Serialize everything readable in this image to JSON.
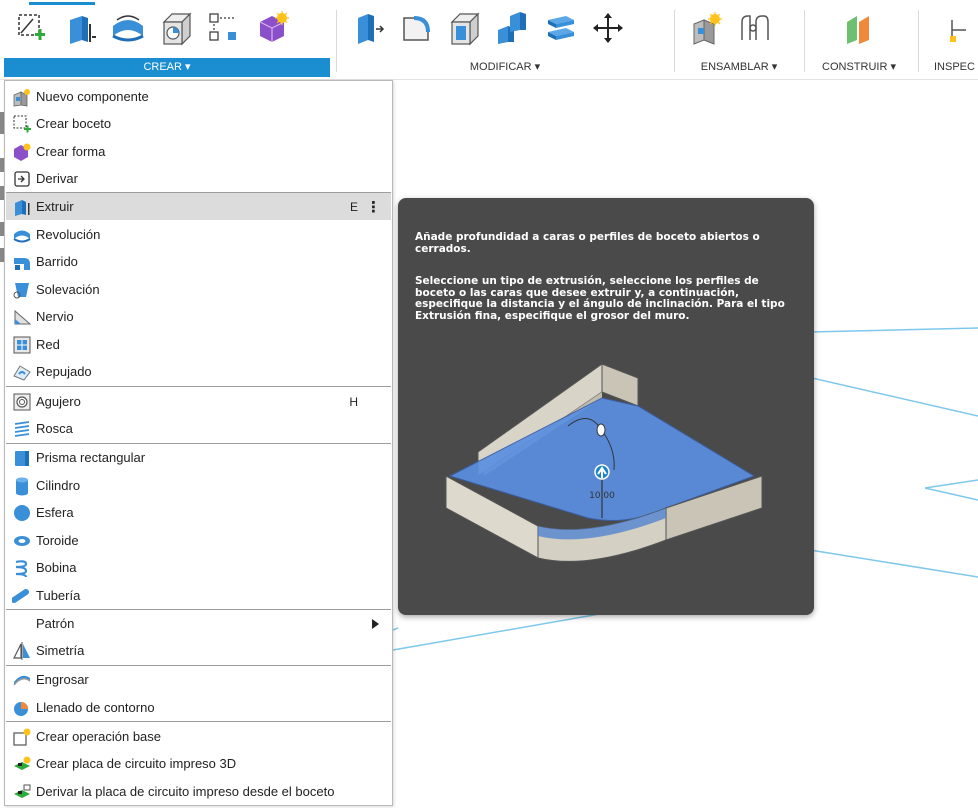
{
  "toolbar": {
    "groups": {
      "crear": "CREAR ▾",
      "modificar": "MODIFICAR ▾",
      "ensamblar": "ENSAMBLAR ▾",
      "construir": "CONSTRUIR ▾",
      "inspeccionar": "INSPEC"
    }
  },
  "menu": {
    "items": [
      {
        "label": "Nuevo componente",
        "shortcut": ""
      },
      {
        "label": "Crear boceto",
        "shortcut": ""
      },
      {
        "label": "Crear forma",
        "shortcut": ""
      },
      {
        "label": "Derivar",
        "shortcut": ""
      },
      {
        "label": "Extruir",
        "shortcut": "E",
        "more": "⋮"
      },
      {
        "label": "Revolución",
        "shortcut": ""
      },
      {
        "label": "Barrido",
        "shortcut": ""
      },
      {
        "label": "Solevación",
        "shortcut": ""
      },
      {
        "label": "Nervio",
        "shortcut": ""
      },
      {
        "label": "Red",
        "shortcut": ""
      },
      {
        "label": "Repujado",
        "shortcut": ""
      },
      {
        "label": "Agujero",
        "shortcut": "H"
      },
      {
        "label": "Rosca",
        "shortcut": ""
      },
      {
        "label": "Prisma rectangular",
        "shortcut": ""
      },
      {
        "label": "Cilindro",
        "shortcut": ""
      },
      {
        "label": "Esfera",
        "shortcut": ""
      },
      {
        "label": "Toroide",
        "shortcut": ""
      },
      {
        "label": "Bobina",
        "shortcut": ""
      },
      {
        "label": "Tubería",
        "shortcut": ""
      },
      {
        "label": "Patrón",
        "shortcut": ""
      },
      {
        "label": "Simetría",
        "shortcut": ""
      },
      {
        "label": "Engrosar",
        "shortcut": ""
      },
      {
        "label": "Llenado de contorno",
        "shortcut": ""
      },
      {
        "label": "Crear operación base",
        "shortcut": ""
      },
      {
        "label": "Crear placa de circuito impreso 3D",
        "shortcut": ""
      },
      {
        "label": "Derivar la placa de circuito impreso desde el boceto",
        "shortcut": ""
      }
    ]
  },
  "tooltip": {
    "paragraph1": "Añade profundidad a caras o perfiles de boceto abiertos o cerrados.",
    "paragraph2": "Seleccione un tipo de extrusión, seleccione los perfiles de boceto o las caras que desee extruir y, a continuación, especifique la distancia y el ángulo de inclinación. Para el tipo Extrusión fina, especifique el grosor del muro.",
    "illustration_value": "10.00"
  },
  "colors": {
    "accent": "#1b8ed1",
    "tooltip_bg": "#4a4a4a",
    "highlight": "#dcdcdc",
    "canvas_lines": "#7ec8ec"
  }
}
